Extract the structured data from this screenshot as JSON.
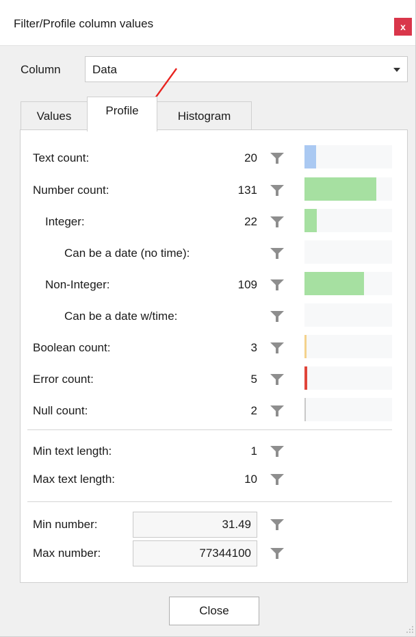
{
  "window": {
    "title": "Filter/Profile column values",
    "close_glyph": "x"
  },
  "column": {
    "label": "Column",
    "value": "Data"
  },
  "tabs": [
    {
      "label": "Values",
      "active": false
    },
    {
      "label": "Profile",
      "active": true
    },
    {
      "label": "Histogram",
      "active": false
    }
  ],
  "profile": {
    "rows": [
      {
        "label": "Text count:",
        "count": "20",
        "fraction": 0.13,
        "color": "#aac9f2"
      },
      {
        "label": "Number count:",
        "count": "131",
        "fraction": 0.82,
        "color": "#a6e0a1"
      },
      {
        "label": "Integer:",
        "count": "22",
        "fraction": 0.14,
        "color": "#a6e0a1"
      },
      {
        "label": "Can be a date (no time):",
        "count": "",
        "fraction": 0,
        "color": "#a6e0a1"
      },
      {
        "label": "Non-Integer:",
        "count": "109",
        "fraction": 0.68,
        "color": "#a6e0a1"
      },
      {
        "label": "Can be a date w/time:",
        "count": "",
        "fraction": 0,
        "color": "#a6e0a1"
      },
      {
        "label": "Boolean count:",
        "count": "3",
        "fraction": 0.02,
        "color": "#f4d28c"
      },
      {
        "label": "Error count:",
        "count": "5",
        "fraction": 0.03,
        "color": "#e0443a"
      },
      {
        "label": "Null count:",
        "count": "2",
        "fraction": 0.01,
        "color": "#c8c8c8"
      }
    ],
    "text_stats": [
      {
        "label": "Min text length:",
        "count": "1"
      },
      {
        "label": "Max text length:",
        "count": "10"
      }
    ],
    "number_stats": [
      {
        "label": "Min number:",
        "value": "31.49"
      },
      {
        "label": "Max number:",
        "value": "77344100"
      }
    ]
  },
  "footer": {
    "close_label": "Close"
  },
  "icons": {
    "filter": "funnel-icon",
    "accent_arrow_color": "#e8231f"
  }
}
